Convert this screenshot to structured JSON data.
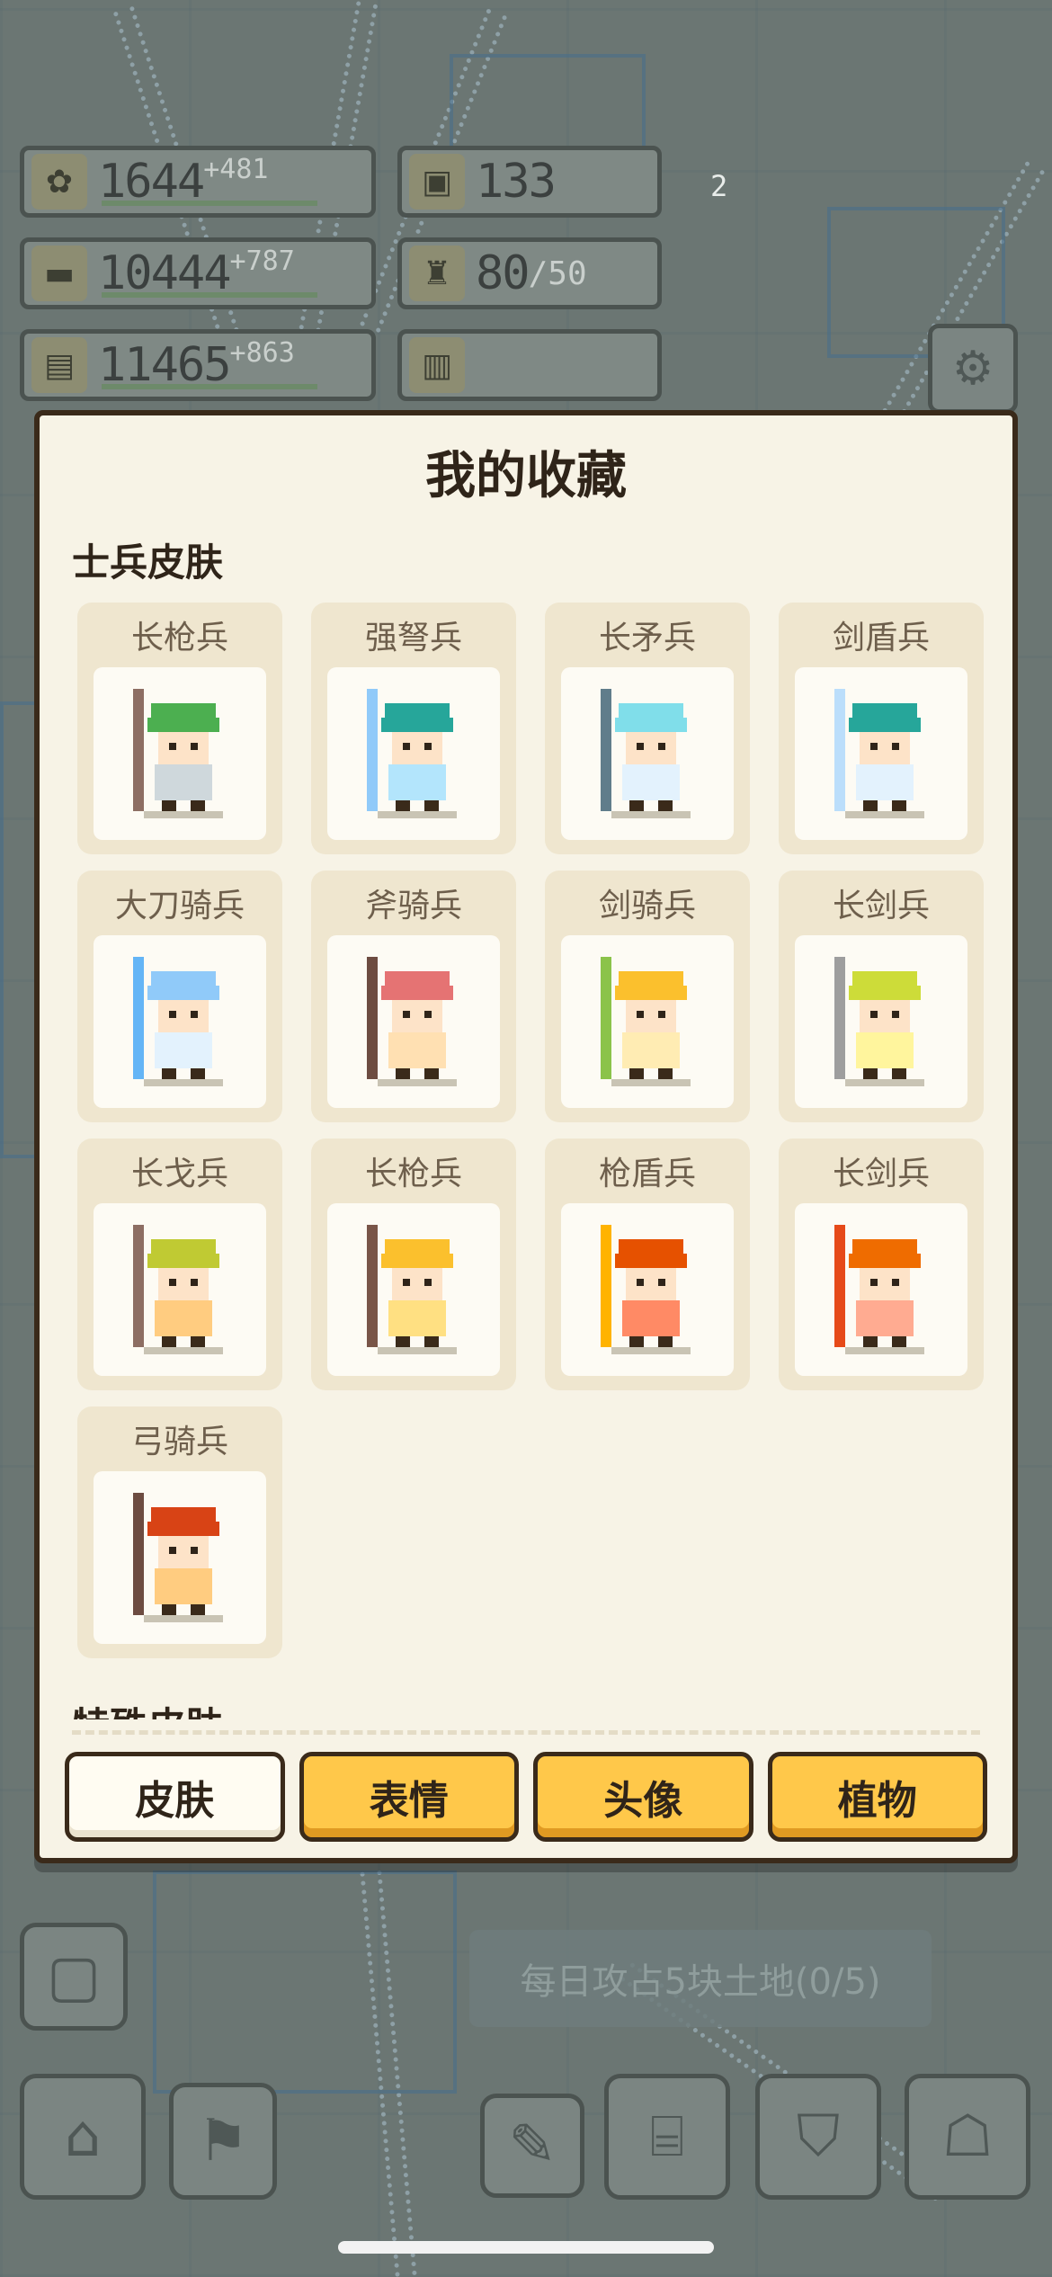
{
  "resources": {
    "food": {
      "value": "1644",
      "increment": "+481",
      "icon": "wheat-icon"
    },
    "gold": {
      "value": "133",
      "icon": "coin-icon"
    },
    "wood": {
      "value": "10444",
      "increment": "+787",
      "icon": "log-icon"
    },
    "troops": {
      "value": "80",
      "cap": "/50",
      "icon": "armor-icon"
    },
    "stone": {
      "value": "11465",
      "increment": "+863",
      "icon": "stone-icon"
    }
  },
  "side_badge": {
    "count": "2"
  },
  "modal": {
    "title": "我的收藏",
    "section_title": "士兵皮肤",
    "next_section_title": "特殊皮肤",
    "skins": [
      {
        "name": "长枪兵",
        "helmet": "#4caf50",
        "body": "#cfd8dc",
        "weapon": "#8d6e63"
      },
      {
        "name": "强弩兵",
        "helmet": "#26a69a",
        "body": "#b3e5fc",
        "weapon": "#90caf9"
      },
      {
        "name": "长矛兵",
        "helmet": "#80deea",
        "body": "#e3f2fd",
        "weapon": "#607d8b"
      },
      {
        "name": "剑盾兵",
        "helmet": "#26a69a",
        "body": "#e3f2fd",
        "weapon": "#bbdefb"
      },
      {
        "name": "大刀骑兵",
        "helmet": "#90caf9",
        "body": "#e3f2fd",
        "weapon": "#64b5f6"
      },
      {
        "name": "斧骑兵",
        "helmet": "#e57373",
        "body": "#ffe0b2",
        "weapon": "#6d4c41"
      },
      {
        "name": "剑骑兵",
        "helmet": "#fbc02d",
        "body": "#ffecb3",
        "weapon": "#8bc34a"
      },
      {
        "name": "长剑兵",
        "helmet": "#cddc39",
        "body": "#fff59d",
        "weapon": "#9e9e9e"
      },
      {
        "name": "长戈兵",
        "helmet": "#c0ca33",
        "body": "#ffcc80",
        "weapon": "#8d6e63"
      },
      {
        "name": "长枪兵",
        "helmet": "#fbc02d",
        "body": "#ffe082",
        "weapon": "#795548"
      },
      {
        "name": "枪盾兵",
        "helmet": "#e65100",
        "body": "#ff8a65",
        "weapon": "#ffb300"
      },
      {
        "name": "长剑兵",
        "helmet": "#ef6c00",
        "body": "#ffab91",
        "weapon": "#e64a19"
      },
      {
        "name": "弓骑兵",
        "helmet": "#d84315",
        "body": "#ffcc80",
        "weapon": "#6d4c41"
      }
    ],
    "tabs": [
      {
        "label": "皮肤",
        "active": true
      },
      {
        "label": "表情",
        "active": false
      },
      {
        "label": "头像",
        "active": false
      },
      {
        "label": "植物",
        "active": false
      }
    ]
  },
  "quest": {
    "text": "每日攻占5块土地(0/5)"
  },
  "bottom_nav": [
    {
      "icon": "home-icon"
    },
    {
      "icon": "flag-icon"
    },
    {
      "icon": "research-icon"
    },
    {
      "icon": "shop-icon"
    },
    {
      "icon": "shield-icon"
    },
    {
      "icon": "chat-icon"
    }
  ]
}
